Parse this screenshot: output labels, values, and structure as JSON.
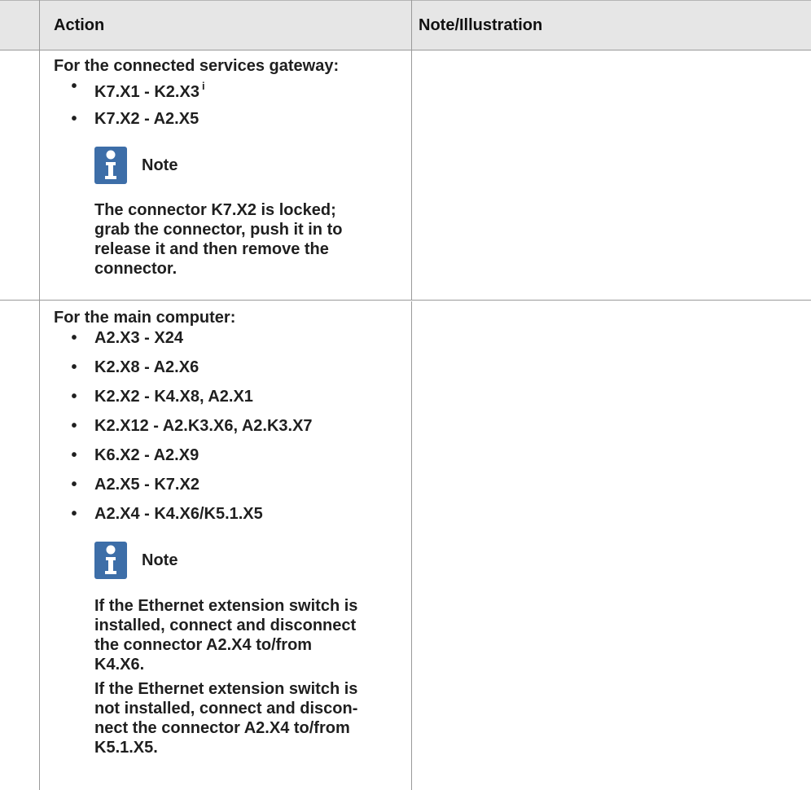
{
  "header": {
    "action_label": "Action",
    "note_label": "Note/Illustration"
  },
  "rows": [
    {
      "title": "For the connected services gateway:",
      "items": [
        "K7.X1 - K2.X3",
        "K7.X2 - A2.X5"
      ],
      "item_superscript": "i",
      "note_title": "Note",
      "note_paragraphs": [
        "The connector K7.X2 is locked; grab the connector, push it in to release it and then remove the connector."
      ]
    },
    {
      "title": "For the main computer:",
      "items": [
        "A2.X3 - X24",
        "K2.X8 - A2.X6",
        "K2.X2 - K4.X8, A2.X1",
        "K2.X12 - A2.K3.X6, A2.K3.X7",
        "K6.X2 - A2.X9",
        "A2.X5 - K7.X2",
        "A2.X4 - K4.X6/K5.1.X5"
      ],
      "note_title": "Note",
      "note_paragraphs": [
        "If the Ethernet extension switch is installed, connect and disconnect the connector A2.X4 to/from K4.X6.",
        "If the Ethernet extension switch is not installed, connect and discon-nect the connector A2.X4 to/from K5.1.X5."
      ]
    }
  ],
  "colors": {
    "header_bg": "#e6e6e6",
    "grid_line": "#9a9a9a",
    "note_icon": "#3d6ea8"
  },
  "icons": {
    "note": "info-icon"
  }
}
